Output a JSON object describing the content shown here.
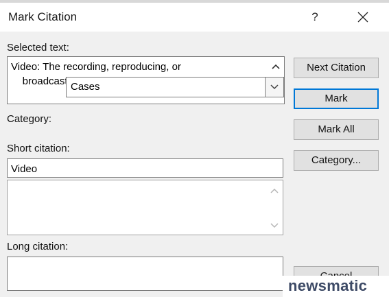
{
  "dialog": {
    "title": "Mark Citation",
    "help_label": "?"
  },
  "selected_text": {
    "label": "Selected text:",
    "line1": "Video: The recording, reproducing, or",
    "line2": "    broadcasting of moving visual images."
  },
  "category": {
    "label": "Category:",
    "value": "Cases"
  },
  "short_citation": {
    "label": "Short citation:",
    "value": "Video"
  },
  "long_citation": {
    "label": "Long citation:"
  },
  "buttons": {
    "next_citation": "Next Citation",
    "mark": "Mark",
    "mark_all": "Mark All",
    "category": "Category...",
    "cancel": "Cancel"
  },
  "watermark": "newsmatic",
  "icons": {
    "close": "close-icon",
    "scroll_up": "chevron-up-icon",
    "scroll_down": "chevron-down-icon",
    "dropdown": "dropdown-arrow-icon"
  },
  "colors": {
    "dialog_bg": "#f0f0f0",
    "default_button_border": "#0078d7",
    "watermark_text": "#3d4a66"
  }
}
